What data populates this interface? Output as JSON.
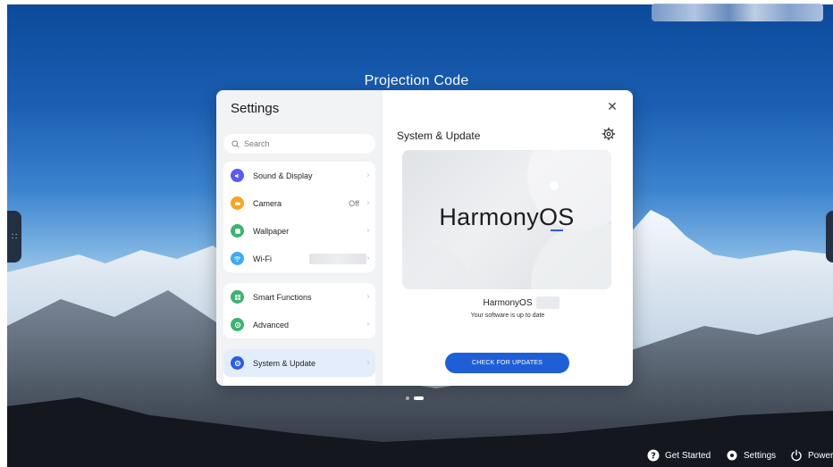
{
  "projection": {
    "title": "Projection Code"
  },
  "settings": {
    "title": "Settings",
    "search_placeholder": "Search",
    "groups": [
      [
        {
          "label": "Sound & Display",
          "icon": "volume-icon",
          "color": "#5b5bf0"
        },
        {
          "label": "Camera",
          "icon": "camera-icon",
          "color": "#f5a623",
          "value": "Off"
        },
        {
          "label": "Wallpaper",
          "icon": "wallpaper-icon",
          "color": "#3cb371"
        },
        {
          "label": "Wi-Fi",
          "icon": "wifi-icon",
          "color": "#3fa9f5"
        }
      ],
      [
        {
          "label": "Smart Functions",
          "icon": "smart-functions-icon",
          "color": "#3cb371"
        },
        {
          "label": "Advanced",
          "icon": "advanced-icon",
          "color": "#3cb371"
        }
      ],
      [
        {
          "label": "System & Update",
          "icon": "system-update-icon",
          "color": "#2b5ee0",
          "selected": true
        }
      ]
    ]
  },
  "detail": {
    "title": "System & Update",
    "logo_text": "HarmonyOS",
    "os_name": "HarmonyOS",
    "status": "Your software is up to date",
    "check_button": "CHECK FOR UPDATES"
  },
  "dock": {
    "get_started": "Get Started",
    "settings": "Settings",
    "power": "Power"
  },
  "colors": {
    "accent": "#1f5fd6",
    "selected_row": "#e4edfb"
  }
}
